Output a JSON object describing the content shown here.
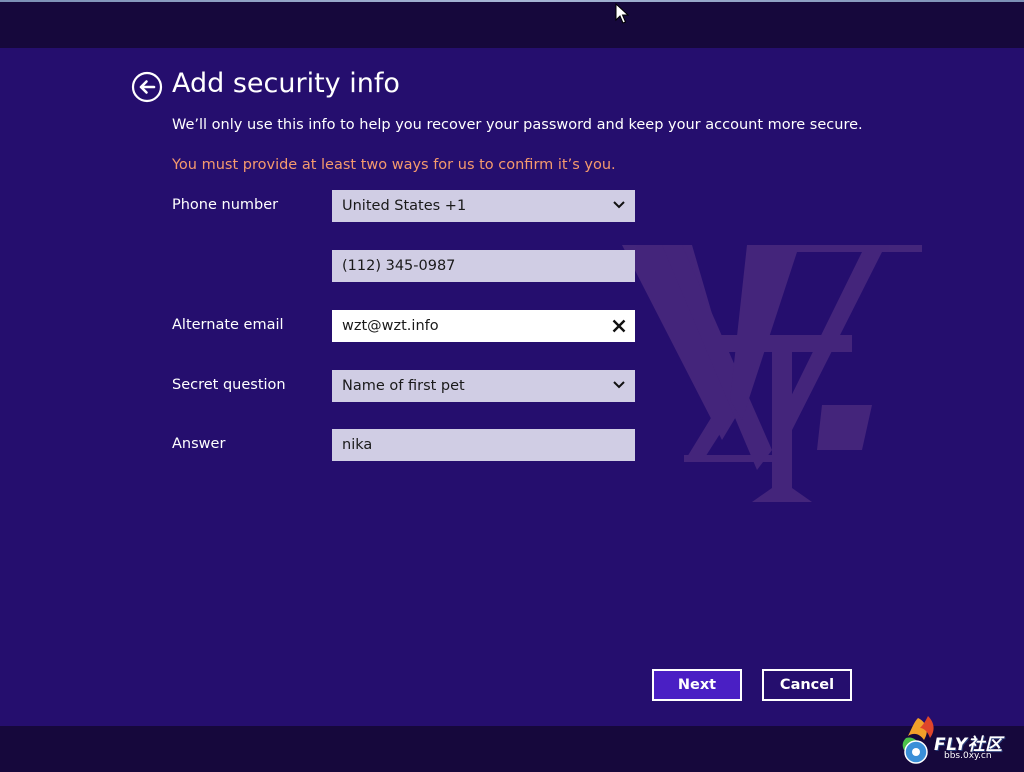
{
  "page": {
    "title": "Add security info",
    "subtitle": "We’ll only use this info to help you recover your password and keep your account more secure.",
    "warning": "You must provide at least two ways for us to confirm it’s you."
  },
  "form": {
    "phone_label": "Phone number",
    "country_value": "United States +1",
    "phone_value": "(112) 345-0987",
    "email_label": "Alternate email",
    "email_value": "wzt@wzt.info",
    "question_label": "Secret question",
    "question_value": "Name of first pet",
    "answer_label": "Answer",
    "answer_value": "nika"
  },
  "buttons": {
    "next_label": "Next",
    "cancel_label": "Cancel"
  },
  "branding": {
    "watermark_icon": "wzt-monogram-icon",
    "site_logo_text": "FLY社区",
    "site_logo_url_text": "bbs.0xy.cn"
  },
  "icons": {
    "back": "back-arrow-icon",
    "dropdown": "chevron-down-icon",
    "clear": "close-icon"
  },
  "colors": {
    "background": "#250e6e",
    "warning_text": "#f59a6d",
    "primary_button": "#4a1fc4",
    "field_background": "#d0cde4"
  }
}
